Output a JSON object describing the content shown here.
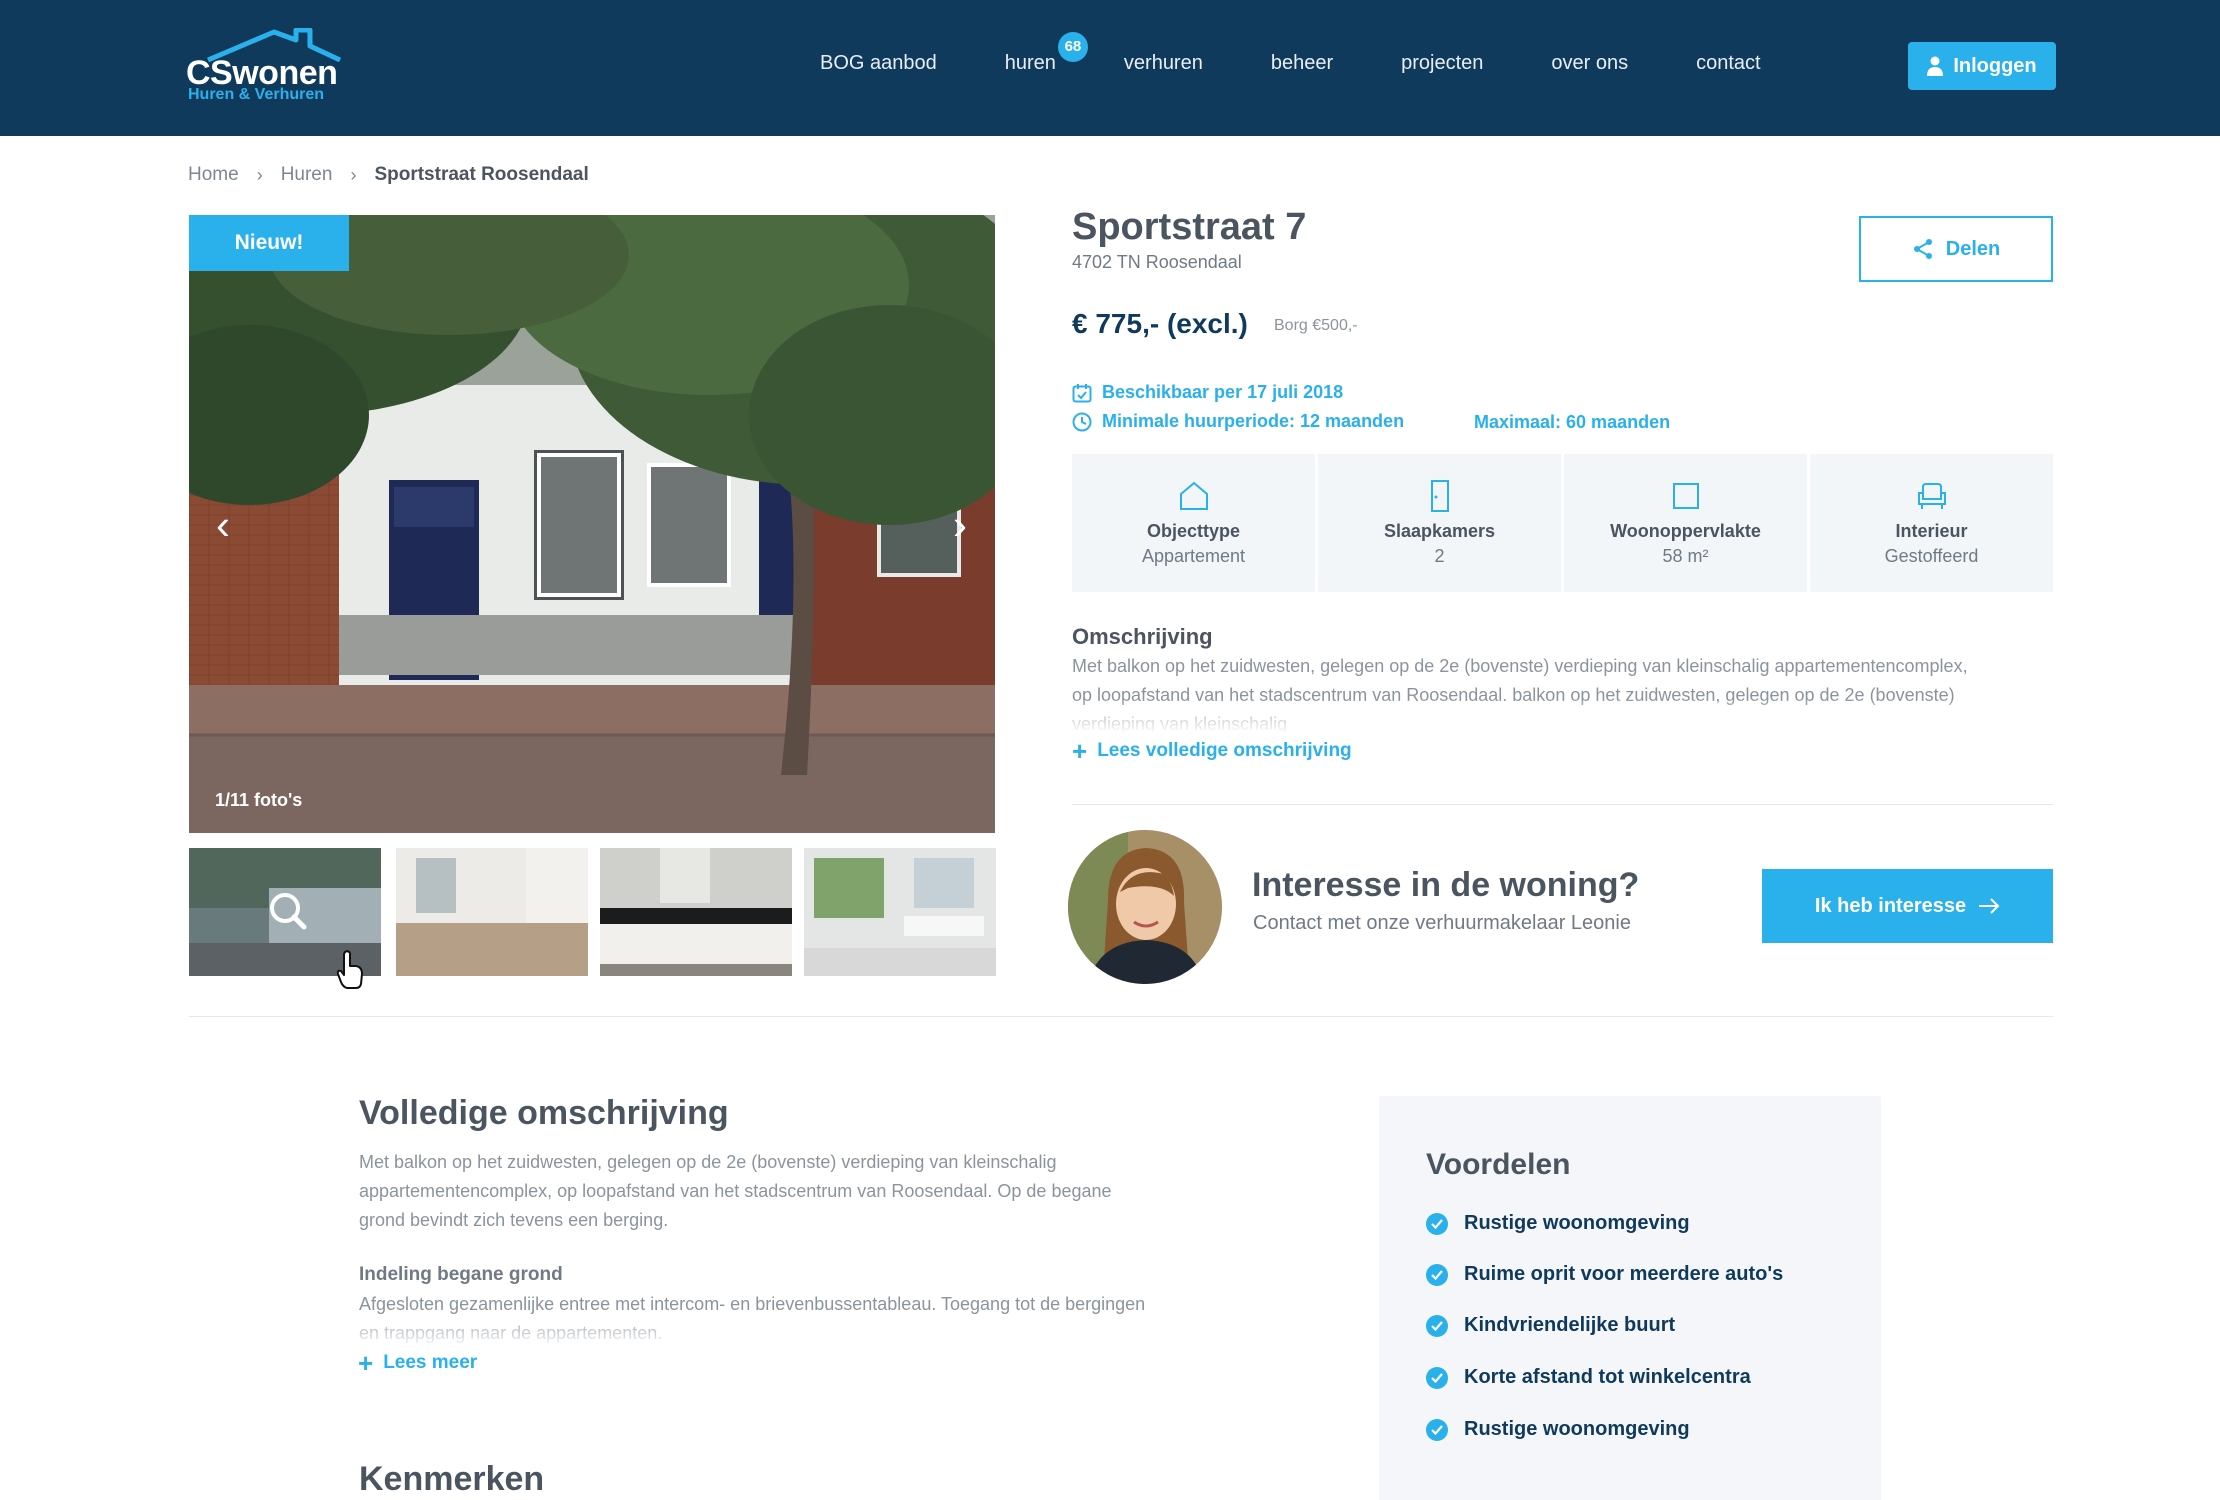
{
  "brand": {
    "name": "CSwonen",
    "tagline": "Huren & Verhuren"
  },
  "nav": {
    "items": [
      {
        "label": "BOG aanbod"
      },
      {
        "label": "huren",
        "badge": "68"
      },
      {
        "label": "verhuren"
      },
      {
        "label": "beheer"
      },
      {
        "label": "projecten"
      },
      {
        "label": "over ons"
      },
      {
        "label": "contact"
      }
    ],
    "login_label": "Inloggen"
  },
  "breadcrumb": [
    "Home",
    "Huren",
    "Sportstraat Roosendaal"
  ],
  "gallery": {
    "badge": "Nieuw!",
    "photo_count": "1/11 foto's"
  },
  "listing": {
    "title": "Sportstraat 7",
    "postcode": "4702 TN Roosendaal",
    "share_label": "Delen",
    "price": "€ 775,- (excl.)",
    "deposit": "Borg €500,-",
    "available": "Beschikbaar per 17 juli 2018",
    "min_period": "Minimale huurperiode: 12 maanden",
    "max_period": "Maximaal: 60 maanden",
    "features": [
      {
        "label": "Objecttype",
        "value": "Appartement",
        "icon": "house-icon"
      },
      {
        "label": "Slaapkamers",
        "value": "2",
        "icon": "door-icon"
      },
      {
        "label": "Woonoppervlakte",
        "value": "58 m²",
        "icon": "square-icon"
      },
      {
        "label": "Interieur",
        "value": "Gestoffeerd",
        "icon": "armchair-icon"
      }
    ],
    "description_title": "Omschrijving",
    "description_text": "Met balkon op het zuidwesten, gelegen op de 2e (bovenste) verdieping van kleinschalig appartementencomplex, op loopafstand van het stadscentrum van Roosendaal. balkon op het zuidwesten, gelegen op de 2e (bovenste) verdieping van kleinschalig",
    "read_full_label": "Lees volledige omschrijving"
  },
  "contact": {
    "title": "Interesse in de woning?",
    "subtitle": "Contact met onze verhuurmakelaar Leonie",
    "button_label": "Ik heb interesse"
  },
  "full_description": {
    "title": "Volledige omschrijving",
    "text": "Met balkon op het zuidwesten, gelegen op de 2e (bovenste) verdieping van kleinschalig appartementencomplex, op loopafstand van het stadscentrum van Roosendaal. Op de begane grond bevindt zich tevens een berging.",
    "section_title": "Indeling begane grond",
    "section_text": "Afgesloten gezamenlijke entree met intercom- en brievenbussentableau. Toegang tot de bergingen en trappgang naar de appartementen.",
    "read_more_label": "Lees meer"
  },
  "kenmerken_title": "Kenmerken",
  "voordelen": {
    "title": "Voordelen",
    "items": [
      "Rustige woonomgeving",
      "Ruime oprit voor meerdere auto's",
      "Kindvriendelijke buurt",
      "Korte afstand tot winkelcentra",
      "Rustige woonomgeving"
    ]
  },
  "colors": {
    "header": "#0f3a5c",
    "accent": "#2ab0ea",
    "text": "#4b5560"
  }
}
